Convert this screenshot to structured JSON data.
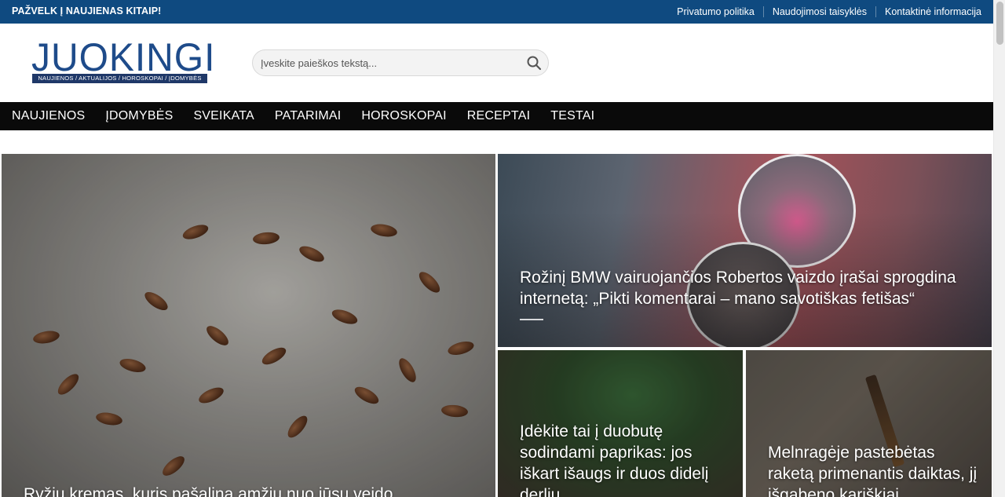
{
  "topbar": {
    "tagline": "PAŽVELK Į NAUJIENAS KITAIP!",
    "links": [
      {
        "label": "Privatumo politika"
      },
      {
        "label": "Naudojimosi taisyklės"
      },
      {
        "label": "Kontaktinė informacija"
      }
    ]
  },
  "header": {
    "logo_word": "JUOKINGI",
    "logo_strip": "NAUJIENOS / AKTUALIJOS / HOROSKOPAI / ĮDOMYBĖS",
    "search_placeholder": "Įveskite paieškos tekstą..."
  },
  "nav": {
    "items": [
      {
        "label": "NAUJIENOS"
      },
      {
        "label": "ĮDOMYBĖS"
      },
      {
        "label": "SVEIKATA"
      },
      {
        "label": "PATARIMAI"
      },
      {
        "label": "HOROSKOPAI"
      },
      {
        "label": "RECEPTAI"
      },
      {
        "label": "TESTAI"
      }
    ]
  },
  "articles": {
    "big": {
      "title": "Ryžių kremas, kuris pašalina amžių nuo jūsų veido"
    },
    "top_right": {
      "title": "Rožinį BMW vairuojančios Robertos vaizdo įrašai sprogdina internetą: „Pikti komentarai – mano savotiškas fetišas“"
    },
    "mid": {
      "title": "Įdėkite tai į duobutę sodindami paprikas: jos iškart išaugs ir duos didelį derlių"
    },
    "right": {
      "title": "Melnragėje pastebėtas raketą primenantis daiktas, jį išgabeno kariškiai"
    }
  },
  "colors": {
    "topbar": "#0f4a80",
    "nav": "#0a0a0a",
    "logo": "#1e4b8a"
  }
}
